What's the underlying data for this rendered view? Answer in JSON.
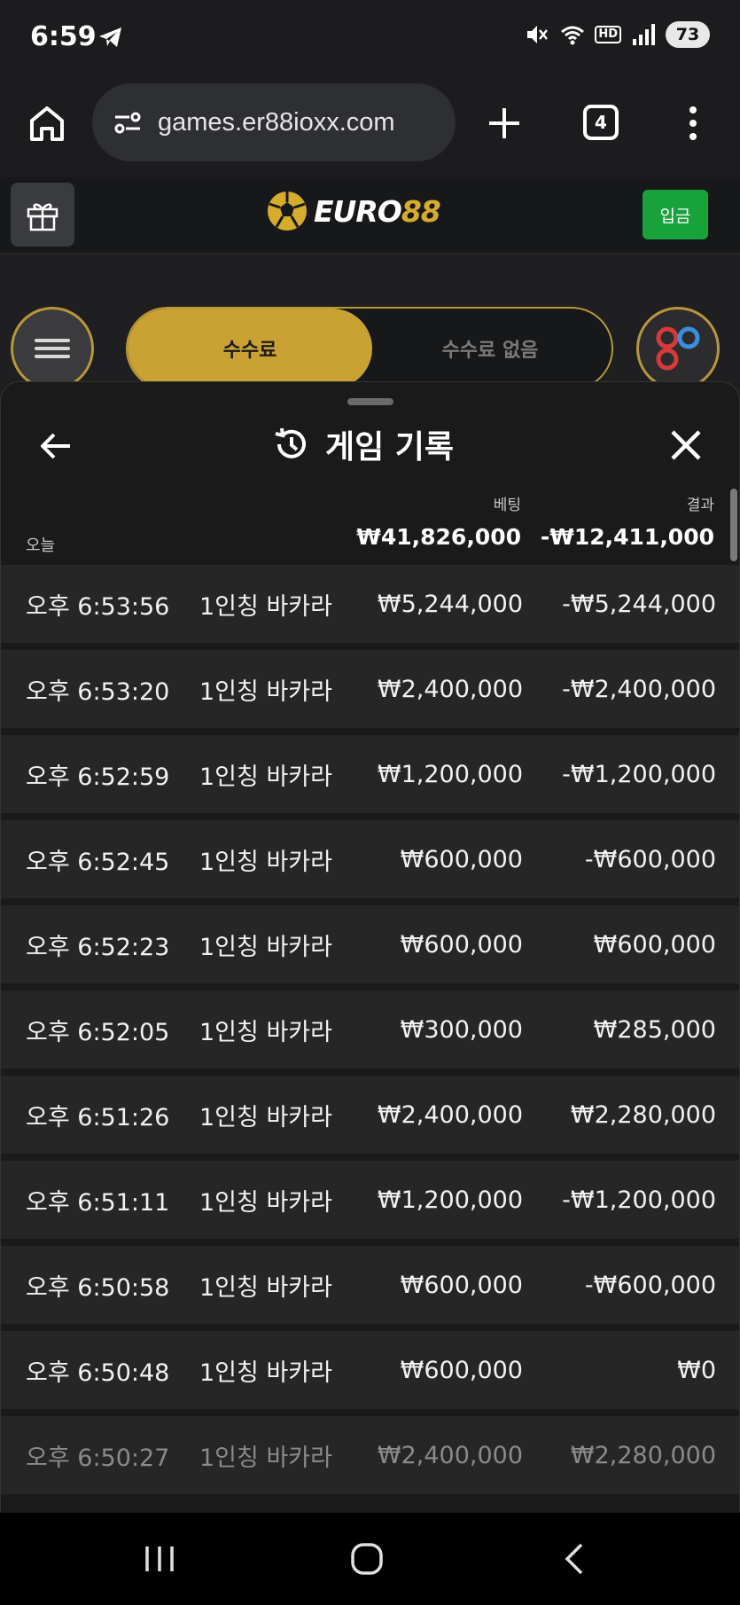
{
  "status_bar": {
    "time": "6:59",
    "hd_label": "HD",
    "battery": "73"
  },
  "browser": {
    "url": "games.er88ioxx.com",
    "tab_count": "4"
  },
  "site_header": {
    "logo_word": "EURO",
    "logo_num": "88",
    "deposit_label": "입금",
    "brand_color": "#c9a233"
  },
  "fee_toggle": {
    "on_label": "수수료",
    "off_label": "수수료 없음"
  },
  "sheet": {
    "title": "게임 기록",
    "bet_header": "베팅",
    "result_header": "결과",
    "today_label": "오늘",
    "today_bet_total": "₩41,826,000",
    "today_result_total": "-₩12,411,000"
  },
  "records": [
    {
      "time": "오후 6:53:56",
      "game": "1인칭 바카라",
      "bet": "₩5,244,000",
      "result": "-₩5,244,000"
    },
    {
      "time": "오후 6:53:20",
      "game": "1인칭 바카라",
      "bet": "₩2,400,000",
      "result": "-₩2,400,000"
    },
    {
      "time": "오후 6:52:59",
      "game": "1인칭 바카라",
      "bet": "₩1,200,000",
      "result": "-₩1,200,000"
    },
    {
      "time": "오후 6:52:45",
      "game": "1인칭 바카라",
      "bet": "₩600,000",
      "result": "-₩600,000"
    },
    {
      "time": "오후 6:52:23",
      "game": "1인칭 바카라",
      "bet": "₩600,000",
      "result": "₩600,000"
    },
    {
      "time": "오후 6:52:05",
      "game": "1인칭 바카라",
      "bet": "₩300,000",
      "result": "₩285,000"
    },
    {
      "time": "오후 6:51:26",
      "game": "1인칭 바카라",
      "bet": "₩2,400,000",
      "result": "₩2,280,000"
    },
    {
      "time": "오후 6:51:11",
      "game": "1인칭 바카라",
      "bet": "₩1,200,000",
      "result": "-₩1,200,000"
    },
    {
      "time": "오후 6:50:58",
      "game": "1인칭 바카라",
      "bet": "₩600,000",
      "result": "-₩600,000"
    },
    {
      "time": "오후 6:50:48",
      "game": "1인칭 바카라",
      "bet": "₩600,000",
      "result": "₩0"
    },
    {
      "time": "오후 6:50:27",
      "game": "1인칭 바카라",
      "bet": "₩2,400,000",
      "result": "₩2,280,000"
    }
  ]
}
